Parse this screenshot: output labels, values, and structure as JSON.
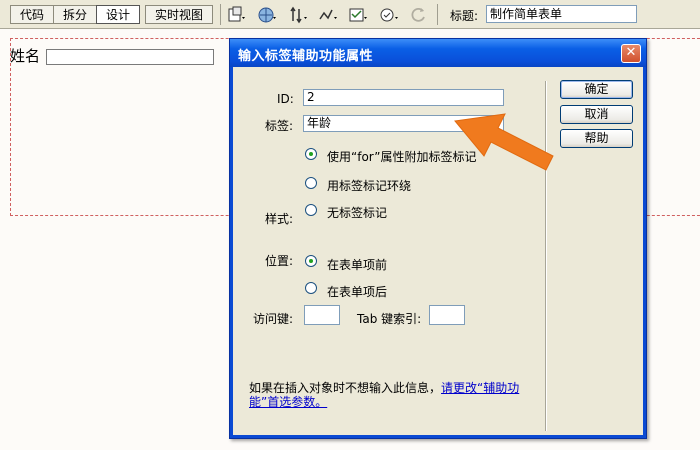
{
  "toolbar": {
    "view_buttons": [
      "代码",
      "拆分",
      "设计",
      "实时视图"
    ],
    "active_view": "设计",
    "title_label": "标题:",
    "title_value": "制作简单表单",
    "icons": [
      "file-management-icon",
      "preview-browser-icon",
      "debug-icon",
      "visual-aids-icon",
      "validate-markup-icon",
      "check-compatibility-icon",
      "refresh-icon"
    ]
  },
  "page": {
    "name_label": "姓名"
  },
  "dialog": {
    "title": "输入标签辅助功能属性",
    "close_glyph": "✕",
    "id_label": "ID:",
    "id_value": "2",
    "label_label": "标签:",
    "label_value": "年龄",
    "style_label": "样式:",
    "style_options": [
      "使用“for”属性附加标签标记",
      "用标签标记环绕",
      "无标签标记"
    ],
    "style_selected": 0,
    "position_label": "位置:",
    "position_options": [
      "在表单项前",
      "在表单项后"
    ],
    "position_selected": 0,
    "access_key_label": "访问键:",
    "access_key_value": "",
    "tab_index_label": "Tab 键索引:",
    "tab_index_value": "",
    "info_text": "如果在插入对象时不想输入此信息，",
    "info_link": "请更改“辅助功能”首选参数。",
    "buttons": {
      "ok": "确定",
      "cancel": "取消",
      "help": "帮助"
    }
  },
  "colors": {
    "titlebar": "#0a4fd9",
    "dialog_bg": "#ece9d8",
    "arrow": "#f07a1e",
    "radio_dot": "#21a121",
    "form_outline": "#d06060"
  }
}
